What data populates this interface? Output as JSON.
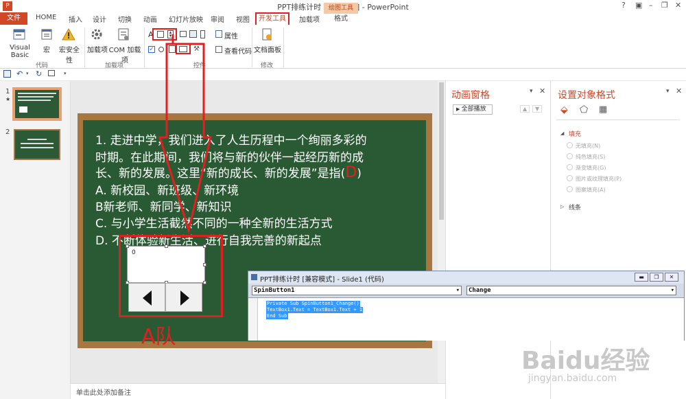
{
  "window": {
    "title": "PPT排练计时 [兼容模式] - PowerPoint",
    "controls": [
      "?",
      "▣",
      "–",
      "❐",
      "✕"
    ]
  },
  "tabs": {
    "file": "文件",
    "items": [
      "HOME",
      "插入",
      "设计",
      "切换",
      "动画",
      "幻灯片放映",
      "审阅",
      "视图"
    ],
    "developer": "开发工具",
    "addins": "加载项",
    "drawing_tools": "绘图工具",
    "format": "格式"
  },
  "ribbon": {
    "code_group": {
      "visual_basic": "Visual Basic",
      "macro": "宏",
      "macro_security": "宏安全性",
      "label": "代码"
    },
    "addins_group": {
      "addins": "加载项",
      "com_addins": "COM 加载项",
      "label": "加载项"
    },
    "controls_group": {
      "properties": "属性",
      "view_code": "查看代码",
      "label": "控件"
    },
    "modify_group": {
      "document_panel": "文档面板",
      "label": "修改"
    }
  },
  "slides": {
    "numbers": [
      "1",
      "2"
    ],
    "star": "★"
  },
  "slide": {
    "lines": [
      "1. 走进中学，我们进入了人生历程中一个绚丽多彩的",
      "时期。在此期间，我们将与新的伙伴一起经历新的成",
      "长、新的发展。这里“新的成长、新的发展”是指(",
      "A. 新校园、新班级、新环境",
      "B新老师、新同学、新知识",
      "C. 与小学生活截然不同的一种全新的生活方式",
      "D. 不断体验新生活、进行自我完善的新起点"
    ],
    "answer": "D",
    "answer_close": ")",
    "textbox_value": "0",
    "annotation": "A队"
  },
  "notes": {
    "placeholder": "单击此处添加备注"
  },
  "animation_pane": {
    "title": "动画窗格",
    "play_all": "全部播放"
  },
  "format_pane": {
    "title": "设置对象格式",
    "fill_section": "填充",
    "fill_options": [
      "无填充(N)",
      "纯色填充(S)",
      "渐变填充(G)",
      "图片或纹理填充(P)",
      "图案填充(A)"
    ],
    "line_section": "线条"
  },
  "vbe": {
    "title": "PPT排练计时 [兼容模式] - Slide1 (代码)",
    "object": "SpinButton1",
    "procedure": "Change",
    "code": [
      "Private Sub SpinButton1_Change()",
      "TextBox1.Text = TextBox1.Text + 1",
      "End Sub"
    ]
  },
  "watermark": {
    "brand": "Baidu经验",
    "url": "jingyan.baidu.com"
  },
  "colors": {
    "accent": "#d24726",
    "board": "#2a5a33",
    "frame": "#a8763f",
    "highlight": "#e02020",
    "selection": "#3399ff"
  }
}
